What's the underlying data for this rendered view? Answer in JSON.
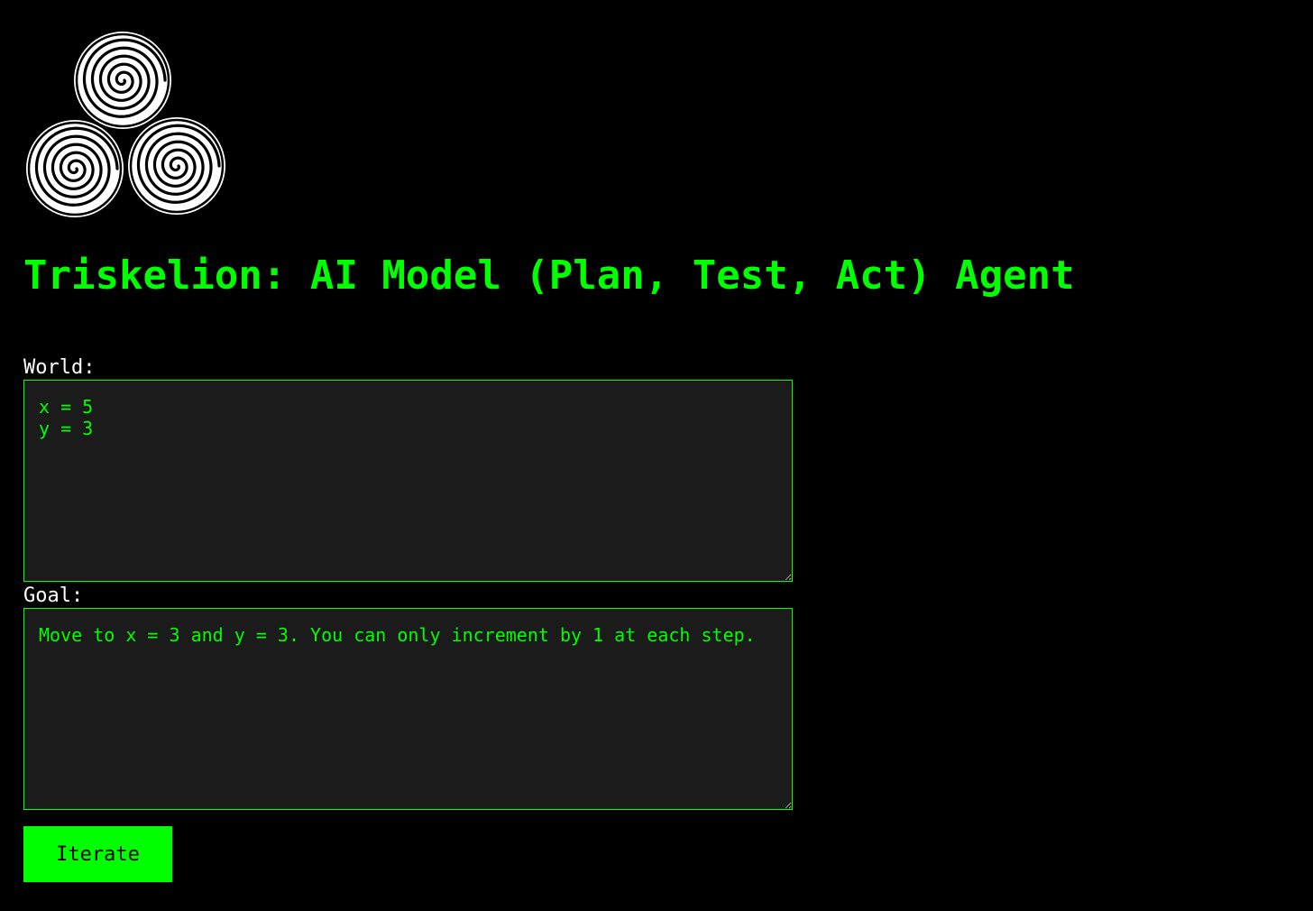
{
  "app": {
    "title": "Triskelion: AI Model (Plan, Test, Act) Agent",
    "logo_icon": "triskelion-spiral-icon"
  },
  "form": {
    "world": {
      "label": "World:",
      "value": "x = 5\ny = 3"
    },
    "goal": {
      "label": "Goal:",
      "value": "Move to x = 3 and y = 3. You can only increment by 1 at each step."
    },
    "iterate_button": {
      "label": "Iterate"
    }
  },
  "colors": {
    "background": "#000000",
    "accent": "#00ff00",
    "textarea_bg": "#1b1b1b",
    "label_text": "#ffffff"
  }
}
